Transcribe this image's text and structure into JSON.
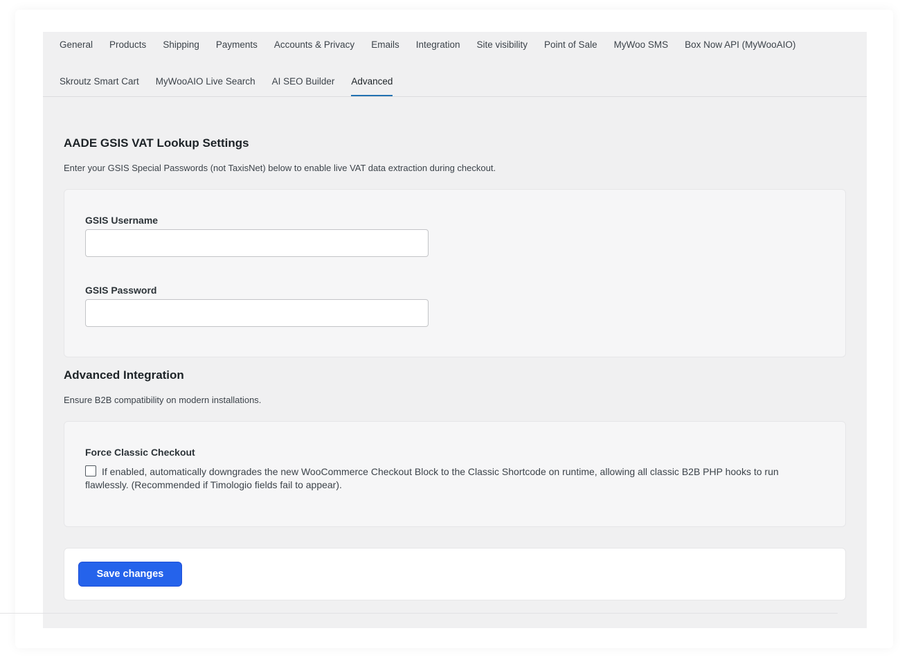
{
  "tabs": {
    "row1": [
      "General",
      "Products",
      "Shipping",
      "Payments",
      "Accounts & Privacy",
      "Emails",
      "Integration",
      "Site visibility",
      "Point of Sale",
      "MyWoo SMS",
      "Box Now API (MyWooAIO)"
    ],
    "row2": [
      "Skroutz Smart Cart",
      "MyWooAIO Live Search",
      "AI SEO Builder",
      "Advanced"
    ],
    "active": "Advanced"
  },
  "gsis": {
    "title": "AADE GSIS VAT Lookup Settings",
    "description": "Enter your GSIS Special Passwords (not TaxisNet) below to enable live VAT data extraction during checkout.",
    "username_label": "GSIS Username",
    "username_value": "",
    "password_label": "GSIS Password",
    "password_value": ""
  },
  "advanced": {
    "title": "Advanced Integration",
    "description": "Ensure B2B compatibility on modern installations.",
    "force_label": "Force Classic Checkout",
    "force_checked": false,
    "force_text": "If enabled, automatically downgrades the new WooCommerce Checkout Block to the Classic Shortcode on runtime, allowing all classic B2B PHP hooks to run flawlessly. (Recommended if Timologio fields fail to appear)."
  },
  "footer": {
    "save_label": "Save changes"
  },
  "colors": {
    "accent": "#2563eb",
    "tab_underline": "#2271b1",
    "panel_bg": "#f0f0f1"
  }
}
